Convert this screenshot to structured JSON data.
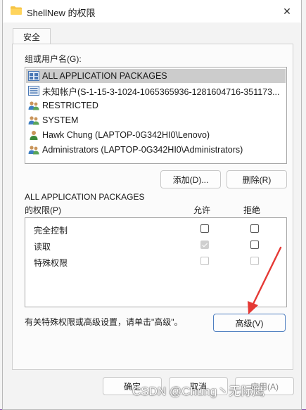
{
  "window": {
    "title": "ShellNew 的权限",
    "close_symbol": "✕"
  },
  "tabs": [
    {
      "label": "安全"
    }
  ],
  "users_section": {
    "label": "组或用户名(G):",
    "users": [
      {
        "name": "ALL APPLICATION PACKAGES",
        "icon": "app-packages-icon",
        "selected": true
      },
      {
        "name": "未知帐户(S-1-15-3-1024-1065365936-1281604716-351173...",
        "icon": "unknown-account-icon",
        "selected": false
      },
      {
        "name": "RESTRICTED",
        "icon": "group-icon",
        "selected": false
      },
      {
        "name": "SYSTEM",
        "icon": "group-icon",
        "selected": false
      },
      {
        "name": "Hawk Chung (LAPTOP-0G342HI0\\Lenovo)",
        "icon": "user-icon",
        "selected": false
      },
      {
        "name": "Administrators (LAPTOP-0G342HI0\\Administrators)",
        "icon": "group-icon",
        "selected": false
      }
    ],
    "add_button": "添加(D)...",
    "remove_button": "删除(R)"
  },
  "permissions_section": {
    "title_line1": "ALL APPLICATION PACKAGES",
    "title_line2": "的权限(P)",
    "allow_header": "允许",
    "deny_header": "拒绝",
    "rows": [
      {
        "name": "完全控制",
        "allow": false,
        "allow_disabled": false,
        "deny": false,
        "deny_disabled": false
      },
      {
        "name": "读取",
        "allow": true,
        "allow_disabled": true,
        "deny": false,
        "deny_disabled": false
      },
      {
        "name": "特殊权限",
        "allow": false,
        "allow_disabled": true,
        "deny": false,
        "deny_disabled": true
      }
    ]
  },
  "advanced_section": {
    "hint": "有关特殊权限或高级设置，请单击\"高级\"。",
    "advanced_button": "高级(V)"
  },
  "footer": {
    "ok_button": "确定",
    "cancel_button": "取消",
    "apply_button": "应用(A)"
  },
  "watermark": "CSDN @Chung丶无际鹰",
  "colors": {
    "background": "#7f46a8",
    "arrow": "#e53935",
    "selection": "#cccccc"
  }
}
